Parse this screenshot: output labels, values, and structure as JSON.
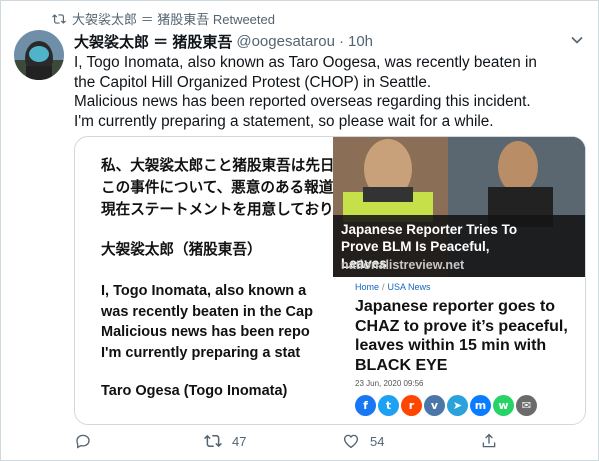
{
  "retweet": {
    "text": "大袈裟太郎 ＝ 猪股東吾 Retweeted"
  },
  "tweet": {
    "name": "大袈裟太郎 ＝ 猪股東吾",
    "handle": "@oogesatarou",
    "separator": "·",
    "time": "10h",
    "lines": [
      "I, Togo Inomata, also known as Taro Oogesa, was recently beaten in",
      "the Capitol Hill Organized Protest (CHOP) in Seattle.",
      "Malicious news has been reported overseas regarding this incident.",
      "I'm currently preparing a statement, so please wait for a while."
    ]
  },
  "media": {
    "jp_lines": [
      "私、大袈裟太郎こと猪股東吾は先日",
      "この事件について、悪意のある報道",
      "現在ステートメントを用意しており"
    ],
    "jp_signature": "大袈裟太郎（猪股東吾）",
    "en_lines": [
      "I, Togo Inomata, also known a",
      "was recently beaten in the Cap",
      "Malicious news has been repo",
      "I'm currently preparing a stat"
    ],
    "en_signature": "Taro Ogesa (Togo Inomata)",
    "banner_headline": "Japanese Reporter Tries To Prove BLM Is Peaceful, Leaves",
    "banner_site": "nationalistreview.net",
    "breadcrumb": [
      "Home",
      "USA News"
    ],
    "breadcrumb_sep": "/",
    "article_title": "Japanese reporter goes to CHAZ to prove it’s peaceful, leaves within 15 min with BLACK EYE",
    "article_date": "23 Jun, 2020 09:56",
    "share_icons": [
      {
        "name": "facebook-share-icon",
        "color": "#1877f2",
        "glyph": "f"
      },
      {
        "name": "twitter-share-icon",
        "color": "#1da1f2",
        "glyph": "t"
      },
      {
        "name": "reddit-share-icon",
        "color": "#ff4500",
        "glyph": "r"
      },
      {
        "name": "vk-share-icon",
        "color": "#4a76a8",
        "glyph": "v"
      },
      {
        "name": "telegram-share-icon",
        "color": "#2aa3dd",
        "glyph": "➤"
      },
      {
        "name": "messenger-share-icon",
        "color": "#0a7cff",
        "glyph": "m"
      },
      {
        "name": "whatsapp-share-icon",
        "color": "#25d366",
        "glyph": "w"
      },
      {
        "name": "email-share-icon",
        "color": "#6b6b6b",
        "glyph": "✉"
      }
    ]
  },
  "actions": {
    "reply_count": "",
    "retweet_count": "47",
    "like_count": "54"
  },
  "colors": {
    "text": "#0f1419",
    "muted": "#536471",
    "border": "#cfd9de"
  }
}
